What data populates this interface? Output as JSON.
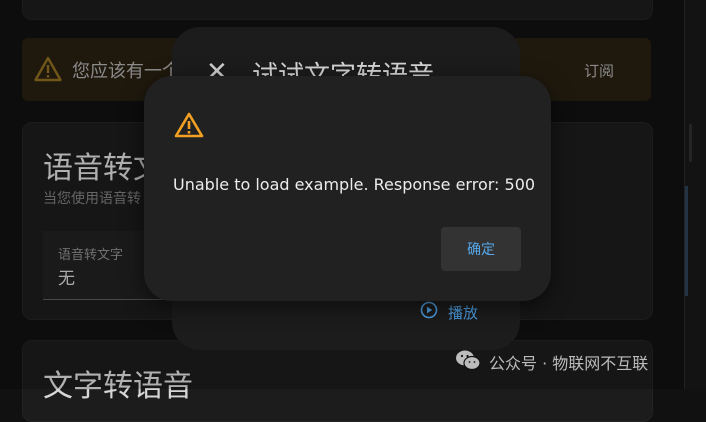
{
  "banner": {
    "text": "您应该有一个",
    "action_label": "订阅"
  },
  "speech_to_text": {
    "title": "语音转文",
    "subtitle": "当您使用语音转",
    "field_label": "语音转文字",
    "field_value": "无"
  },
  "text_to_speech": {
    "title": "文字转语音"
  },
  "background_dialog": {
    "close_symbol": "✕",
    "title": "试试文字转语音",
    "play_label": "播放"
  },
  "error_dialog": {
    "message": "Unable to load example. Response error: 500",
    "confirm_label": "确定"
  },
  "watermark": {
    "text": "公众号 · 物联网不互联"
  },
  "colors": {
    "warning": "#f2a023",
    "accent_blue": "#4d9fe2",
    "background": "#111111",
    "dialog": "#212121"
  }
}
